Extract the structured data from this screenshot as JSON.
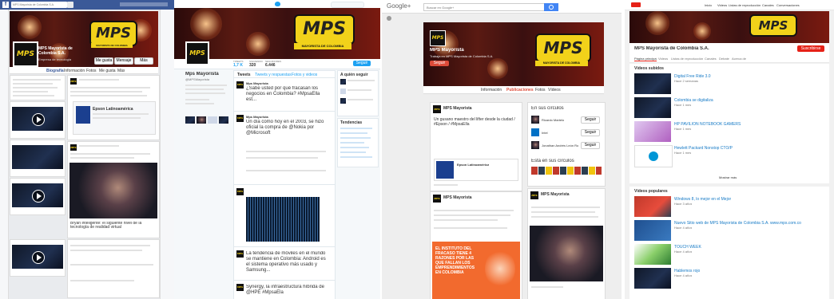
{
  "brand": {
    "logo_text": "MPS",
    "logo_sub": "MAYORISTA DE COLOMBIA",
    "yellow": "#f2d21a",
    "dark": "#111111"
  },
  "facebook": {
    "search_placeholder": "MPS Mayorista de Colombia S.A.",
    "page_name": "MPS Mayorista de Colombia S.A.",
    "category": "Empresa de tecnología",
    "buttons": [
      "Me gusta",
      "Mensaje",
      "Más"
    ],
    "tabs": [
      "Biografía",
      "Información",
      "Fotos",
      "Me gusta",
      "Más"
    ],
    "post_title": "Epson Latinoamérica",
    "post_caption": "Bryan inteligente: el siguiente nivel de la tecnología de realidad virtual",
    "accent": "#3b5998"
  },
  "twitter": {
    "profile_name": "Mps Mayorista",
    "handle": "@MPSMayorista",
    "stats": {
      "tweets_label": "TWEETS",
      "tweets": "1,7 K",
      "following_label": "SIGUIENDO",
      "following": "320",
      "followers_label": "SEGUIDORES",
      "followers": "6.446"
    },
    "follow_button": "Seguir",
    "tabs": [
      "Tweets",
      "Tweets y respuestas",
      "Fotos y videos"
    ],
    "tweets": [
      {
        "author": "Mps Mayorista",
        "text": "¿Sabe usted por qué fracasan los negocios en Colombia? #MpsaElla est..."
      },
      {
        "author": "Mps Mayorista",
        "text": "Un día como hoy en el 2003, se hizo oficial la compra de @Nokia por @Microsoft"
      },
      {
        "author": "Mps Mayorista",
        "text": "La tendencia de móviles en el mundo se mantiene en Colombia: Android es el sistema operativo más usado y Samsung..."
      },
      {
        "author": "Mps Mayorista",
        "text": "Synergy, la infraestructura híbrida de @HPE #MpsaEla"
      }
    ],
    "sidebar_title": "A quién seguir",
    "trends_title": "Tendencias"
  },
  "gplus": {
    "brand": "Google+",
    "search_placeholder": "Buscar en Google+",
    "page_name": "MPS Mayorista",
    "tagline": "Trabaja en MPS Mayorista de Colombia S.A.",
    "follow_button": "Seguir",
    "tabs": [
      "Información",
      "Publicaciones",
      "Fotos",
      "Vídeos"
    ],
    "circles_title": "En sus círculos",
    "circles_people": [
      "Ricardo Martelo",
      "Intel",
      "Jonathan Andrés León Rodríguez"
    ],
    "add_label": "Seguir",
    "in_circles_title": "Está en sus círculos",
    "post_author": "MPS Mayorista",
    "post_text": "Un gusano maestro del lifter desde la ciudad / #Epson / #MpsaElla",
    "card_title": "Epson Latinoamérica",
    "promo_text": "EL INSTITUTO DEL FRACASO TIENE 4 RAZONES POR LAS QUE FALLAN LOS EMPRENDIMIENTOS EN COLOMBIA",
    "accent": "#dd4b39",
    "promo_color": "#f26a2e",
    "blue": "#4285f4"
  },
  "youtube": {
    "channel_name": "MPS Mayorista de Colombia S.A.",
    "subscribe_button": "Suscribirse",
    "top_nav": [
      "Inicio",
      "Videos",
      "Listas de reproducción",
      "Canales",
      "Conversaciones"
    ],
    "tabs": [
      "Página principal",
      "Videos",
      "Listas de reproducción",
      "Canales",
      "Debate",
      "Acerca de"
    ],
    "section1_title": "Vídeos subidos",
    "videos": [
      {
        "title": "Digital Free Ride 3.0",
        "meta": "Hace 2 semanas"
      },
      {
        "title": "Colombia se digitaliza",
        "meta": "Hace 1 mes"
      },
      {
        "title": "HP PAVILION NOTEBOOK GAMERS",
        "meta": "Hace 1 mes"
      },
      {
        "title": "Hewlett Packard Nonstop CTO/P",
        "meta": "Hace 1 mes"
      }
    ],
    "more_label": "Mostrar más",
    "section2_title": "Vídeos populares",
    "popular": [
      {
        "title": "Windows 8, lo mejor en el Mejor",
        "meta": "Hace 3 años"
      },
      {
        "title": "Nuevo Sitio web de MPS Mayorista de Colombia S.A. www.mps.com.co",
        "meta": "Hace 4 años"
      },
      {
        "title": "TOUCH WEEK",
        "meta": "Hace 4 años"
      },
      {
        "title": "Hablemos rojo",
        "meta": "Hace 4 años"
      }
    ],
    "red": "#e62117"
  }
}
